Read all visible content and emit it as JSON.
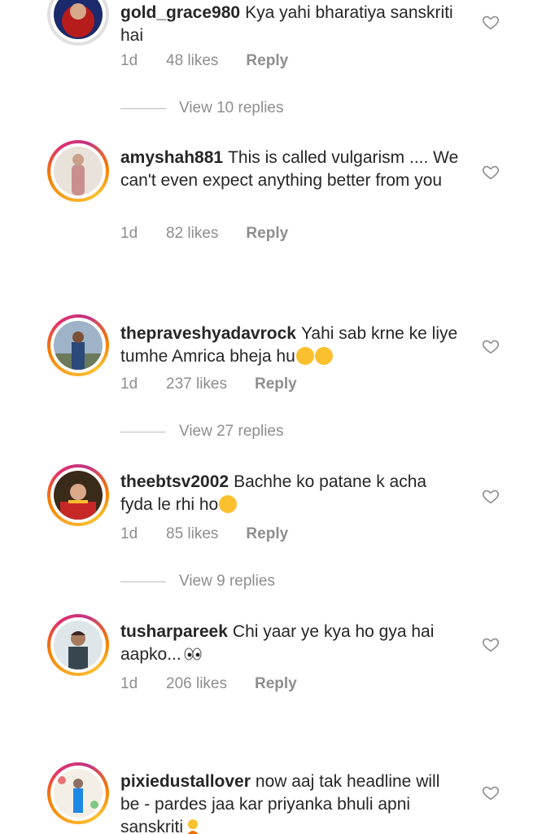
{
  "comments": [
    {
      "username": "gold_grace980",
      "text": "Kya yahi bharatiya sanskriti hai",
      "time": "1d",
      "likes": "48 likes",
      "reply": "Reply",
      "view_replies": "View 10 replies"
    },
    {
      "username": "amyshah881",
      "text": "This is called vulgarism .... We can't even expect anything better from you",
      "time": "1d",
      "likes": "82 likes",
      "reply": "Reply"
    },
    {
      "username": "thepraveshyadavrock",
      "text": "Yahi sab krne ke liye tumhe Amrica bheja hu",
      "time": "1d",
      "likes": "237 likes",
      "reply": "Reply",
      "view_replies": "View 27 replies"
    },
    {
      "username": "theebtsv2002",
      "text": "Bachhe ko patane k acha fyda le rhi ho",
      "time": "1d",
      "likes": "85 likes",
      "reply": "Reply",
      "view_replies": "View 9 replies"
    },
    {
      "username": "tusharpareek",
      "text": "Chi yaar ye kya ho gya hai aapko...",
      "time": "1d",
      "likes": "206 likes",
      "reply": "Reply"
    },
    {
      "username": "pixiedustallover",
      "text": "now aaj tak headline will be - pardes jaa kar priyanka bhuli apni sanskriti"
    }
  ],
  "icons": {
    "like": "heart-outline-icon",
    "laugh": "face-with-tears-of-joy-emoji",
    "eyes": "eyes-emoji",
    "shrug": "person-shrugging-emoji"
  },
  "colors": {
    "ring_start": "#f9a825",
    "ring_mid": "#e1306c",
    "meta_text": "#8e8e8e",
    "text": "#262626"
  }
}
